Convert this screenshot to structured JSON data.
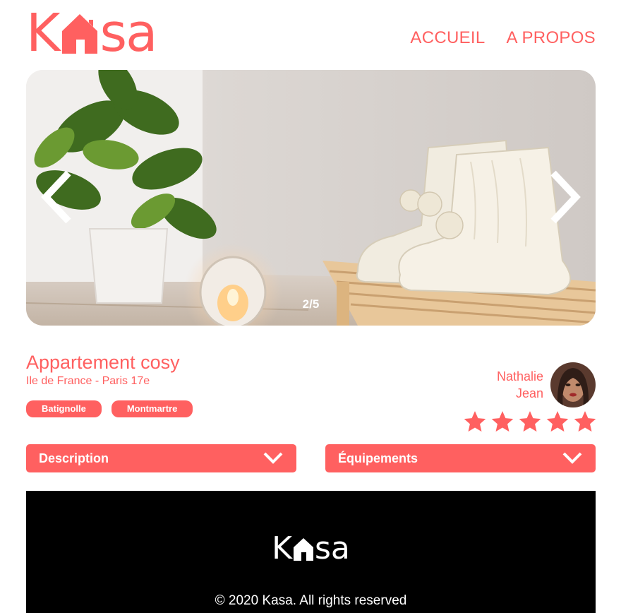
{
  "brand": {
    "logo_letters": [
      "K",
      "sa"
    ],
    "accent_color": "#FF6060"
  },
  "nav": {
    "home": "ACCUEIL",
    "about": "A PROPOS"
  },
  "slideshow": {
    "counter": "2/5",
    "prev_icon": "chevron-left-icon",
    "next_icon": "chevron-right-icon"
  },
  "listing": {
    "title": "Appartement cosy",
    "location": "Ile de France - Paris 17e",
    "tags": [
      "Batignolle",
      "Montmartre"
    ],
    "rating": 5,
    "rating_max": 5
  },
  "host": {
    "first_name": "Nathalie",
    "last_name": "Jean"
  },
  "collapses": {
    "description": "Description",
    "equipements": "Équipements"
  },
  "footer": {
    "copyright": "© 2020 Kasa. All rights reserved"
  }
}
